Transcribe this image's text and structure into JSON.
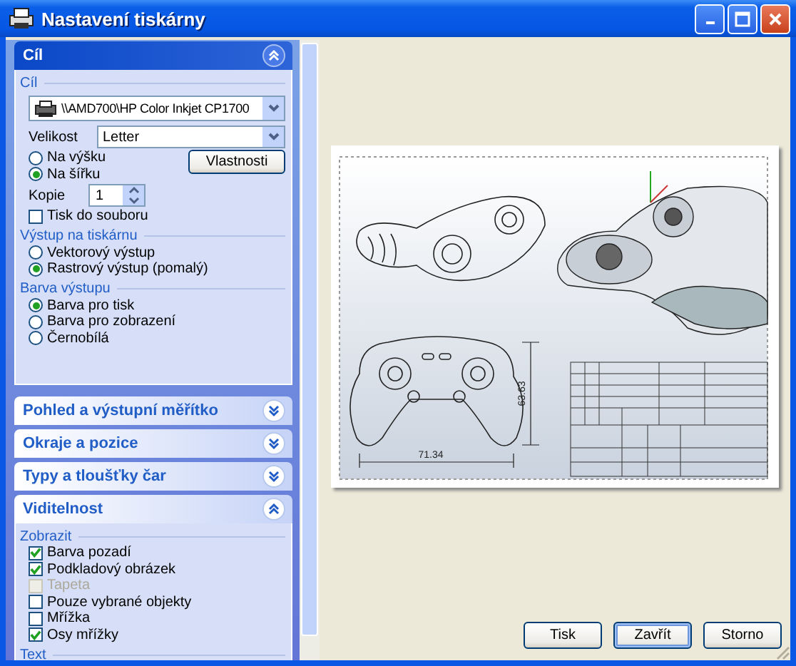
{
  "window": {
    "title": "Nastavení tiskárny"
  },
  "panels": [
    {
      "title": "Cíl",
      "expanded": true,
      "dark": true,
      "groups": [
        {
          "title": "Cíl",
          "items": [
            {
              "kind": "printer",
              "value": "\\\\AMD700\\HP Color Inkjet CP1700"
            },
            {
              "kind": "select",
              "label": "Velikost",
              "value": "Letter"
            },
            {
              "kind": "orientation",
              "options": [
                {
                  "label": "Na výšku",
                  "selected": false
                },
                {
                  "label": "Na šířku",
                  "selected": true
                }
              ],
              "button": "Vlastnosti"
            },
            {
              "kind": "spinner",
              "label": "Kopie",
              "value": "1"
            },
            {
              "kind": "checkbox",
              "label": "Tisk do souboru",
              "checked": false,
              "disabled": false
            }
          ]
        },
        {
          "title": "Výstup na tiskárnu",
          "items": [
            {
              "kind": "radio",
              "label": "Vektorový výstup",
              "selected": false
            },
            {
              "kind": "radio",
              "label": "Rastrový výstup (pomalý)",
              "selected": true
            }
          ]
        },
        {
          "title": "Barva výstupu",
          "items": [
            {
              "kind": "radio",
              "label": "Barva pro tisk",
              "selected": true
            },
            {
              "kind": "radio",
              "label": "Barva pro zobrazení",
              "selected": false
            },
            {
              "kind": "radio",
              "label": "Černobílá",
              "selected": false
            }
          ]
        }
      ]
    },
    {
      "title": "Pohled a výstupní měřítko",
      "expanded": false,
      "dark": false
    },
    {
      "title": "Okraje a pozice",
      "expanded": false,
      "dark": false
    },
    {
      "title": "Typy a tloušťky čar",
      "expanded": false,
      "dark": false
    },
    {
      "title": "Viditelnost",
      "expanded": true,
      "dark": false,
      "groups": [
        {
          "title": "Zobrazit",
          "items": [
            {
              "kind": "checkbox",
              "label": "Barva pozadí",
              "checked": true,
              "disabled": false
            },
            {
              "kind": "checkbox",
              "label": "Podkladový obrázek",
              "checked": true,
              "disabled": false
            },
            {
              "kind": "checkbox",
              "label": "Tapeta",
              "checked": false,
              "disabled": true
            },
            {
              "kind": "checkbox",
              "label": "Pouze vybrané objekty",
              "checked": false,
              "disabled": false
            },
            {
              "kind": "checkbox",
              "label": "Mřížka",
              "checked": false,
              "disabled": false
            },
            {
              "kind": "checkbox",
              "label": "Osy mřížky",
              "checked": true,
              "disabled": false
            }
          ]
        },
        {
          "title": "Text"
        }
      ]
    }
  ],
  "preview": {
    "width_dimension": "71.34",
    "height_dimension": "63.63"
  },
  "buttons": [
    {
      "label": "Tisk",
      "focused": false
    },
    {
      "label": "Zavřít",
      "focused": true
    },
    {
      "label": "Storno",
      "focused": false
    }
  ]
}
